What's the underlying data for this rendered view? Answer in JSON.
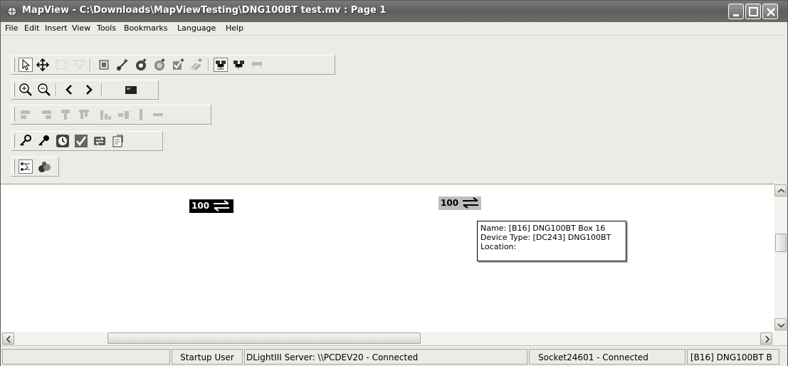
{
  "window": {
    "title": "MapView - C:\\Downloads\\MapViewTesting\\DNG100BT test.mv : Page 1",
    "icon": "mapview-app-icon"
  },
  "menu": [
    "File",
    "Edit",
    "Insert",
    "View",
    "Tools",
    "Bookmarks",
    "Language",
    "Help"
  ],
  "toolbars": {
    "row1": [
      "pointer-icon",
      "pan-icon",
      "rect-select-icon",
      "lasso-select-icon",
      "device-icon",
      "link-icon",
      "add-device-icon",
      "add-group-icon",
      "add-check-icon",
      "add-sparkle-icon",
      "network-view-icon",
      "network-alt-icon",
      "network-disabled-icon"
    ],
    "row2": [
      "zoom-in-icon",
      "zoom-out-icon",
      "back-icon",
      "forward-icon",
      "fullscreen-icon"
    ],
    "row3": [
      "align-left-icon",
      "align-right-icon",
      "align-top-icon",
      "align-bottom-icon",
      "distribute-h-icon",
      "distribute-v-icon",
      "resize-icon",
      "connect-icon"
    ],
    "row4": [
      "key-icon",
      "key-alt-icon",
      "clock-icon",
      "checkmark-icon",
      "switch-icon",
      "properties-icon"
    ],
    "row5": [
      "tree-view-icon",
      "objects-view-icon"
    ]
  },
  "canvas": {
    "devices": [
      {
        "label": "100",
        "state": "selected",
        "icon": "bidirectional-arrows-icon"
      },
      {
        "label": "100",
        "state": "unselected",
        "icon": "bidirectional-arrows-icon"
      }
    ],
    "tooltip": {
      "name": "Name: [B16] DNG100BT Box 16",
      "device_type": "Device Type: [DC243] DNG100BT",
      "location": "Location:"
    }
  },
  "status": {
    "user": "Startup User",
    "server": "DLightIII Server: \\\\PCDEV20  - Connected",
    "socket": "Socket24601 - Connected",
    "selection": "[B16] DNG100BT B"
  }
}
